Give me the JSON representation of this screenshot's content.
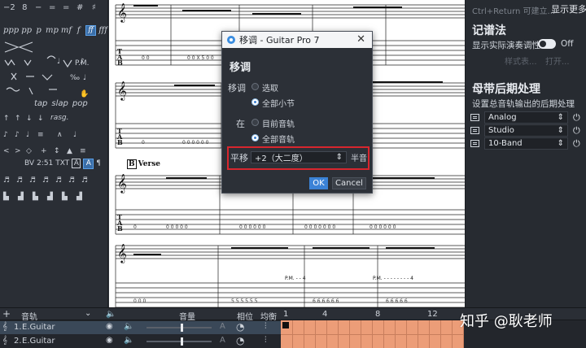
{
  "palette": {
    "row1": [
      "−2",
      "8",
      "−",
      "=",
      "=",
      "#",
      "♯"
    ],
    "row2": [
      "ppp",
      "pp",
      "p",
      "mp",
      "mf",
      "f",
      "ff",
      "fff"
    ],
    "row_pm": "P.M.",
    "row_techniques": [
      "tap",
      "slap",
      "pop"
    ],
    "row_rasg": "rasg.",
    "row_text": [
      "BV",
      "2:51",
      "TXT",
      "A",
      "A",
      "¶"
    ]
  },
  "score": {
    "section_marker": "B",
    "section_name": "Verse",
    "pm_label_1": "P.M. - - 4",
    "pm_label_2": "P.M. - - - - - - - - 4"
  },
  "right_panel": {
    "shortcut_hint": "Ctrl+Return 可建立...",
    "more_button": "显示更多",
    "notation_header": "记谱法",
    "show_pitch_label": "显示实际演奏调性",
    "show_pitch_state": "Off",
    "style_button": "样式表...",
    "open_button": "打开...",
    "master_header": "母带后期处理",
    "master_desc": "设置总音轨输出的后期处理",
    "effects": [
      {
        "name": "Analog"
      },
      {
        "name": "Studio"
      },
      {
        "name": "10-Band"
      }
    ]
  },
  "dialog": {
    "title": "移调 - Guitar Pro 7",
    "close": "✕",
    "heading": "移调",
    "transpose_label": "移调",
    "opt_selection": "选取",
    "opt_all_bars": "全部小节",
    "in_label": "在",
    "opt_current_track": "目前音轨",
    "opt_all_tracks": "全部音轨",
    "shift_label": "平移",
    "shift_value": "+2（大二度）",
    "unit": "半音",
    "ok": "OK",
    "cancel": "Cancel"
  },
  "tracks": {
    "header_track": "音轨",
    "header_volume": "音量",
    "header_phase": "相位",
    "header_eq": "均衡",
    "bar_numbers": [
      "1",
      "4",
      "8",
      "12"
    ],
    "rows": [
      {
        "index": "1.",
        "name": "E.Guitar"
      },
      {
        "index": "2.",
        "name": "E.Guitar"
      }
    ]
  },
  "watermark": "知乎 @耿老师",
  "colors": {
    "accent": "#3b82d6",
    "highlight_box": "#d8262e",
    "timeline_block": "#ec9d78"
  }
}
